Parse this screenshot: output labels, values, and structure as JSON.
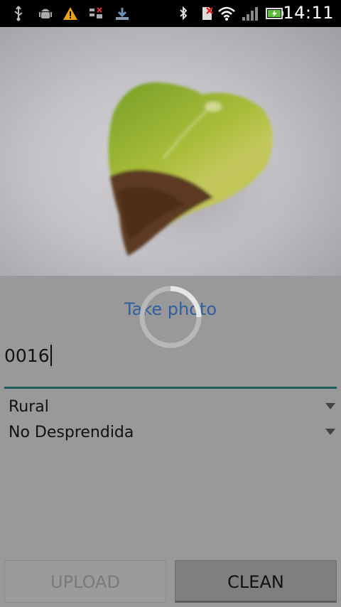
{
  "status_bar": {
    "time": "14:11",
    "left_icons": [
      "usb-icon",
      "android-debug-icon",
      "warning-icon",
      "sim-error-icon",
      "download-icon"
    ],
    "right_icons": [
      "bluetooth-icon",
      "no-sim-icon",
      "wifi-icon",
      "signal-icon",
      "battery-charging-icon"
    ]
  },
  "photo": {
    "subject_icon": "leaf-photo"
  },
  "take_photo_label": "Take photo",
  "code_field": {
    "value": "0016"
  },
  "spinners": [
    {
      "selected": "Rural"
    },
    {
      "selected": "No Desprendida"
    }
  ],
  "buttons": {
    "upload_label": "UPLOAD",
    "clean_label": "CLEAN"
  },
  "colors": {
    "accent": "#2f5f9e",
    "underline": "#1c5f5a",
    "background": "#999999"
  }
}
